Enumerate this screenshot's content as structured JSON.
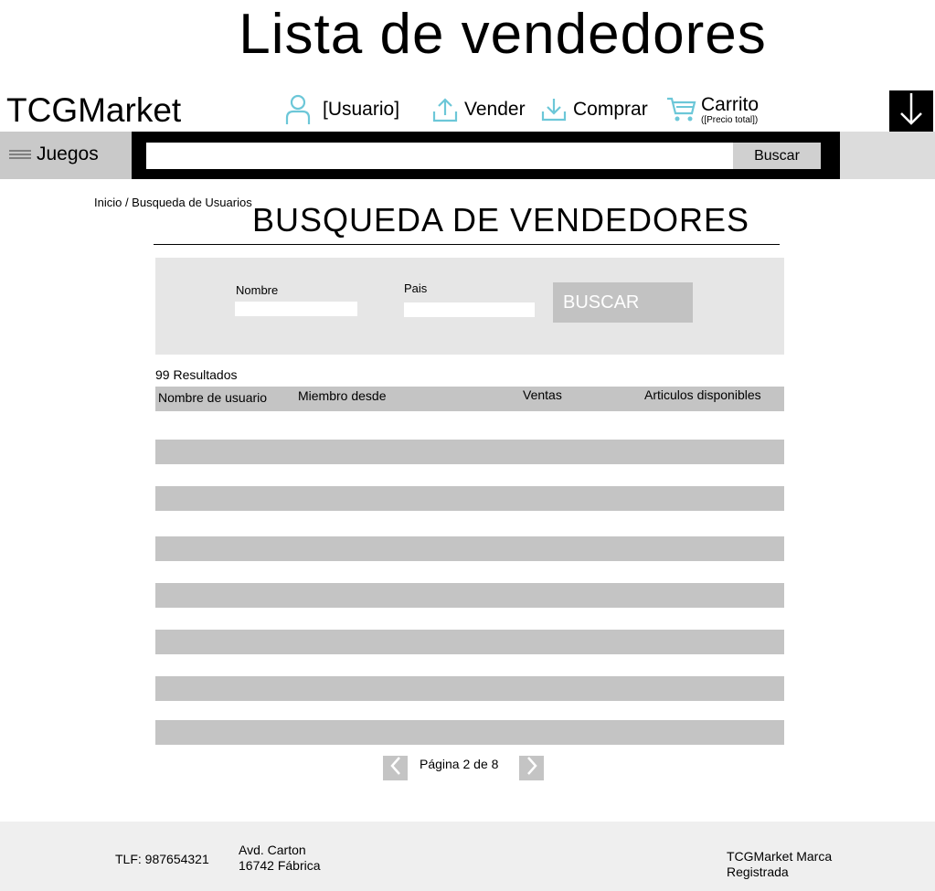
{
  "page_heading": "Lista de vendedores",
  "header": {
    "brand": "TCGMarket",
    "user_label": "[Usuario]",
    "sell_label": "Vender",
    "buy_label": "Comprar",
    "cart_label": "Carrito",
    "cart_total": "([Precio total])",
    "icon_color": "#6cc7d8"
  },
  "topbar": {
    "games_label": "Juegos",
    "search_placeholder": "",
    "search_button": "Buscar"
  },
  "breadcrumb": "Inicio / Busqueda de Usuarios",
  "section_title": "BUSQUEDA DE VENDEDORES",
  "filters": {
    "name_label": "Nombre",
    "name_value": "",
    "country_label": "Pais",
    "country_value": "",
    "search_button": "BUSCAR"
  },
  "results": {
    "count_text": "99 Resultados",
    "columns": [
      "Nombre de usuario",
      "Miembro desde",
      "Ventas",
      "Articulos disponibles"
    ]
  },
  "pagination": {
    "text": "Página 2 de 8"
  },
  "footer": {
    "phone": "TLF: 987654321",
    "address_line1": "Avd. Carton",
    "address_line2": "16742 Fábrica",
    "brand_line1": "TCGMarket Marca",
    "brand_line2": "Registrada"
  }
}
